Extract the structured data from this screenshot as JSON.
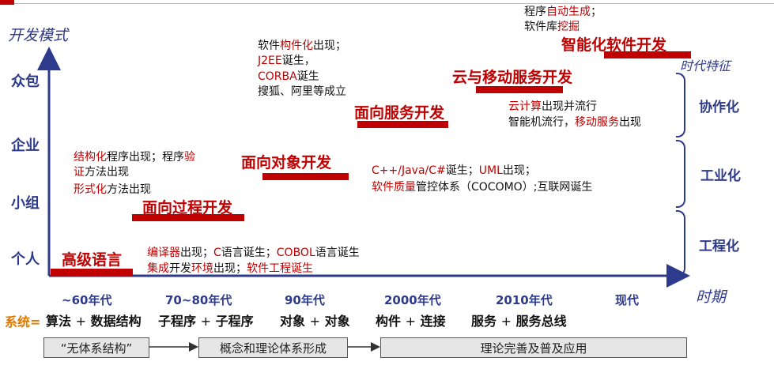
{
  "top_left_accent_color": "#c00000",
  "axis": {
    "y_label": "开发模式",
    "x_label": "时期",
    "y_levels": [
      "众包",
      "企业",
      "小组",
      "个人"
    ]
  },
  "periods": [
    "~60年代",
    "70~80年代",
    "90年代",
    "2000年代",
    "2010年代",
    "现代"
  ],
  "system": {
    "prefix": "系统=",
    "items": [
      {
        "a": "算法",
        "plus": "+",
        "b": "数据结构"
      },
      {
        "a": "子程序",
        "plus": "+",
        "b": "子程序"
      },
      {
        "a": "对象",
        "plus": "+",
        "b": "对象"
      },
      {
        "a": "构件",
        "plus": "+",
        "b": "连接"
      },
      {
        "a": "服务",
        "plus": "+",
        "b": "服务总线"
      }
    ]
  },
  "stages": [
    "高级语言",
    "面向过程开发",
    "面向对象开发",
    "面向服务开发",
    "云与移动服务开发",
    "智能化软件开发"
  ],
  "notes": {
    "n1": {
      "l1a": "编译器",
      "l1b": "出现；",
      "l1c": "C",
      "l1d": "语言诞生；",
      "l1e": "COBOL",
      "l1f": "语言诞生",
      "l2a": "集成",
      "l2b": "开发",
      "l2c": "环境",
      "l2d": "出现；",
      "l2e": "软件工程诞生"
    },
    "n2": {
      "l1a": "结构化",
      "l1b": "程序出现；程序",
      "l1c": "验",
      "l2a": "证",
      "l2b": "方法出现",
      "l3a": "形式化",
      "l3b": "方法出现"
    },
    "n3": {
      "l1a": "软件",
      "l1b": "构件化",
      "l1c": "出现；",
      "l2a": "J2EE",
      "l2b": "诞生，",
      "l3a": "CORBA",
      "l3b": "诞生",
      "l4": "搜狐、阿里等成立"
    },
    "n4": {
      "l1a": "C++/Java/C#",
      "l1b": "诞生；",
      "l1c": "UML",
      "l1d": "出现；",
      "l2a": "软件质量",
      "l2b": "管控体系（COCOMO）;互联网诞生"
    },
    "n5": {
      "l1a": "云计算",
      "l1b": "出现并流行",
      "l2a": "智能机流行，",
      "l2b": "移动服务",
      "l2c": "出现"
    },
    "n6": {
      "l1a": "程序",
      "l1b": "自动生成",
      "l1c": "；",
      "l2a": "软件库",
      "l2b": "挖掘"
    }
  },
  "era_features": {
    "title": "时代特征",
    "items": [
      "协作化",
      "工业化",
      "工程化"
    ]
  },
  "bottom_flow": [
    "“无体系结构”",
    "概念和理论体系形成",
    "理论完善及普及应用"
  ]
}
